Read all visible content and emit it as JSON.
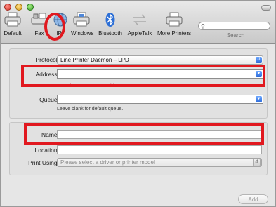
{
  "toolbar": {
    "items": [
      {
        "label": "Default"
      },
      {
        "label": "Fax"
      },
      {
        "label": "IP"
      },
      {
        "label": "Windows"
      },
      {
        "label": "Bluetooth"
      },
      {
        "label": "AppleTalk"
      },
      {
        "label": "More Printers"
      }
    ],
    "search_label": "Search",
    "search_value": ""
  },
  "form": {
    "protocol_label": "Protocol:",
    "protocol_value": "Line Printer Daemon – LPD",
    "address_label": "Address:",
    "address_value": "",
    "address_hint": "Enter host name or IP address.",
    "queue_label": "Queue:",
    "queue_value": "",
    "queue_hint": "Leave blank for default queue.",
    "name_label": "Name:",
    "name_value": "",
    "location_label": "Location:",
    "location_value": "",
    "print_using_label": "Print Using:",
    "print_using_value": "Please select a driver or printer model"
  },
  "footer": {
    "add_label": "Add"
  },
  "colors": {
    "highlight": "#e1181f",
    "accent_blue": "#2b6ad9"
  }
}
